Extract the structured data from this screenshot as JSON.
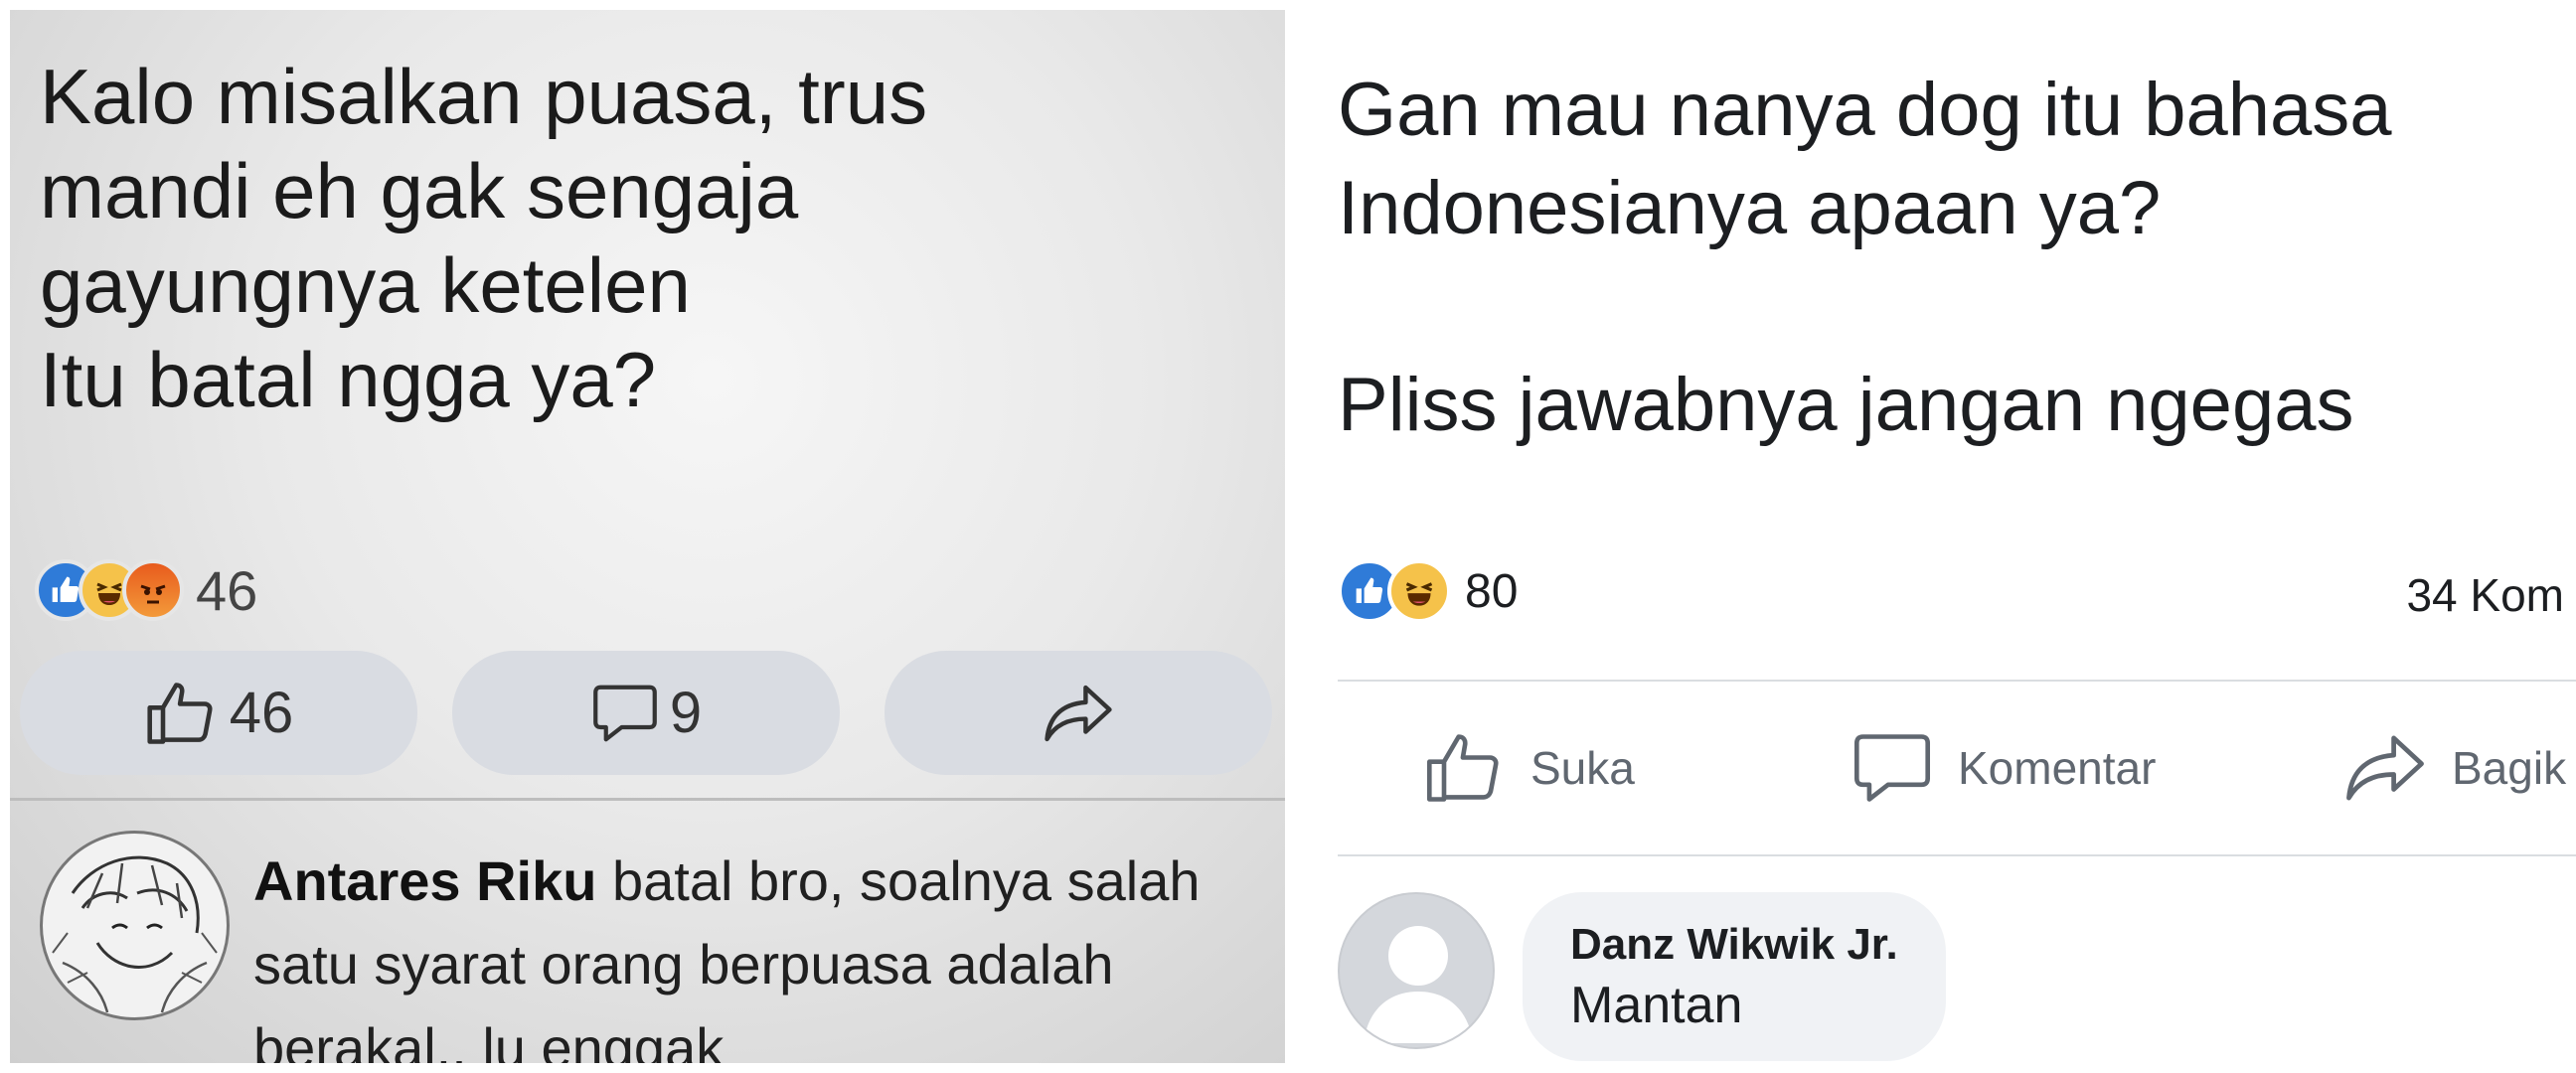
{
  "left_post": {
    "text_lines": [
      "Kalo misalkan puasa, trus",
      "mandi eh gak sengaja",
      "gayungnya ketelen",
      "Itu batal ngga ya?"
    ],
    "reaction_icons": [
      "like-icon",
      "haha-icon",
      "angry-icon"
    ],
    "reaction_count": "46",
    "like_count": "46",
    "comment_count": "9",
    "comment": {
      "author": "Antares Riku",
      "text_line1": "batal bro, soalnya salah",
      "text_line2": "satu syarat orang berpuasa adalah",
      "text_line3": "berakal.. lu enggak"
    }
  },
  "right_post": {
    "text_lines": [
      "Gan mau nanya dog itu bahasa",
      "Indonesianya apaan ya?",
      "",
      "Pliss jawabnya jangan ngegas"
    ],
    "reaction_icons": [
      "like-icon",
      "haha-icon"
    ],
    "reaction_count": "80",
    "comments_count": "34 Kom",
    "actions": {
      "like": "Suka",
      "comment": "Komentar",
      "share": "Bagik"
    },
    "comment": {
      "author": "Danz Wikwik Jr.",
      "text": "Mantan"
    }
  },
  "colors": {
    "like_blue": "#2f7bd8",
    "haha_yellow": "#f5c24a",
    "angry_orange": "#e85b1d",
    "text_dark": "#1c1e21",
    "muted": "#606770",
    "divider": "#dadde1",
    "bubble_bg": "#f0f2f5"
  }
}
